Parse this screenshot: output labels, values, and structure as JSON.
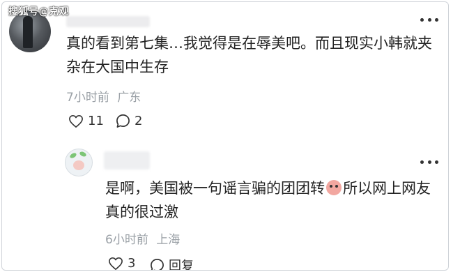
{
  "watermark": "搜狐号@克观",
  "comment": {
    "text": "真的看到第七集…我觉得是在辱美吧。而且现实小韩就夹杂在大国中生存",
    "time": "7小时前",
    "location": "广东",
    "likes": "11",
    "replies": "2"
  },
  "reply": {
    "text_before_emoji": "是啊，美国被一句谣言骗的团团转",
    "emoji_icon": "crying-laughing-face-icon",
    "text_after_emoji": "所以网上网友真的很过激",
    "time": "6小时前",
    "location": "上海",
    "likes": "3",
    "reply_label": "回复"
  }
}
